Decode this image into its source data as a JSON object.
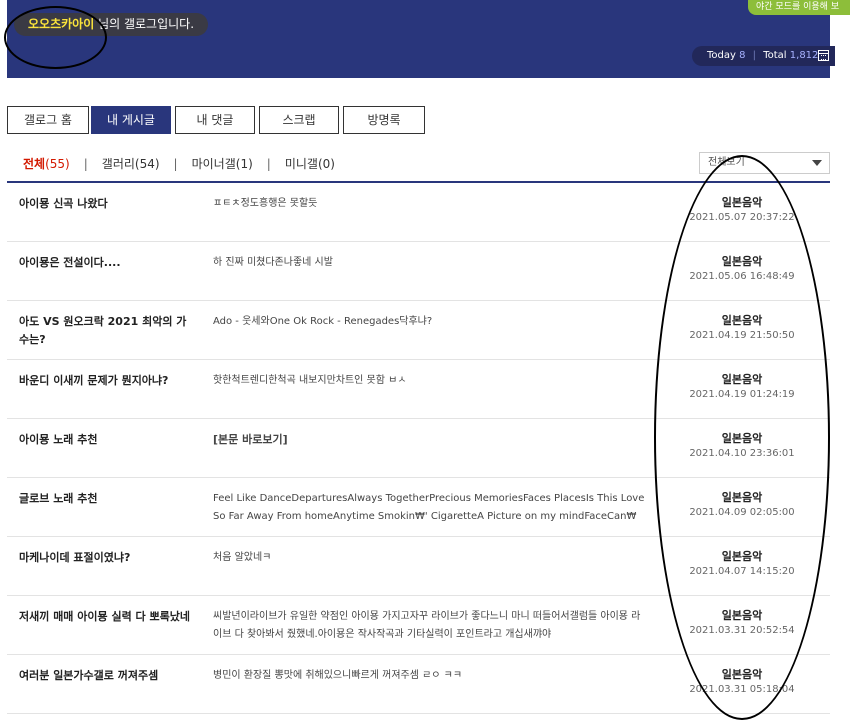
{
  "header": {
    "nickname": "오오츠카아이",
    "title_suffix": "님의 갤로그입니다.",
    "night_mode": "야간 모드를 이용해 보",
    "today_label": "Today",
    "today_value": "8",
    "total_label": "Total",
    "total_value": "1,812",
    "calendar_icon": "calendar-icon"
  },
  "tabs": [
    {
      "label": "갤로그 홈"
    },
    {
      "label": "내 게시글"
    },
    {
      "label": "내 댓글"
    },
    {
      "label": "스크랩"
    },
    {
      "label": "방명록"
    }
  ],
  "filters": [
    {
      "label": "전체",
      "count": "(55)"
    },
    {
      "label": "갤러리",
      "count": "(54)"
    },
    {
      "label": "마이너갤",
      "count": "(1)"
    },
    {
      "label": "미니갤",
      "count": "(0)"
    }
  ],
  "select": {
    "value": "전체보기"
  },
  "posts": [
    {
      "title": "아이묭 신곡 나왔다",
      "content": "ㅍㅌㅊ정도흥행은 못할듯",
      "gallery": "일본음악",
      "date": "2021.05.07 20:37:22"
    },
    {
      "title": "아이묭은 전설이다....",
      "content": "하 진짜 미쳤다존나좋네 시발",
      "gallery": "일본음악",
      "date": "2021.05.06 16:48:49"
    },
    {
      "title": "아도 VS 원오크락 2021 최악의 가수는?",
      "content": "Ado - 웃세와One Ok Rock - Renegades닥후냐?",
      "gallery": "일본음악",
      "date": "2021.04.19 21:50:50"
    },
    {
      "title": "바운디 이새끼 문제가 뭔지아냐?",
      "content": "핫한척트렌디한척곡 내보지만차트인 못함 ㅂㅅ",
      "gallery": "일본음악",
      "date": "2021.04.19 01:24:19"
    },
    {
      "title": "아이묭 노래 추천",
      "content": "[본문 바로보기]",
      "gallery": "일본음악",
      "date": "2021.04.10 23:36:01"
    },
    {
      "title": "글로브 노래 추천",
      "content": "Feel Like DanceDeparturesAlways TogetherPrecious MemoriesFaces PlacesIs This LoveSo Far Away From homeAnytime Smokin₩' CigaretteA Picture on my mindFaceCan₩",
      "gallery": "일본음악",
      "date": "2021.04.09 02:05:00"
    },
    {
      "title": "마케나이데 표절이였냐?",
      "content": "처음 알았네ㅋ",
      "gallery": "일본음악",
      "date": "2021.04.07 14:15:20"
    },
    {
      "title": "저새끼 매매 아이묭 실력 다 뽀록났네",
      "content": "씨발년이라이브가 유일한 약점인 아이묭 가지고자꾸 라이브가 좋다느니 마니 떠들어서갤럼들 아이묭 라이브 다 찾아봐서 줬했네.아이묭은 작사작곡과 기타실력이 포인트라고 개십새꺄야",
      "gallery": "일본음악",
      "date": "2021.03.31 20:52:54"
    },
    {
      "title": "여러분 일본가수갤로 꺼져주셈",
      "content": "병민이 환장질 뽕맛에 취해있으니빠르게 꺼져주셈 ㄹㅇ ㅋㅋ",
      "gallery": "일본음악",
      "date": "2021.03.31 05:18:04"
    }
  ]
}
